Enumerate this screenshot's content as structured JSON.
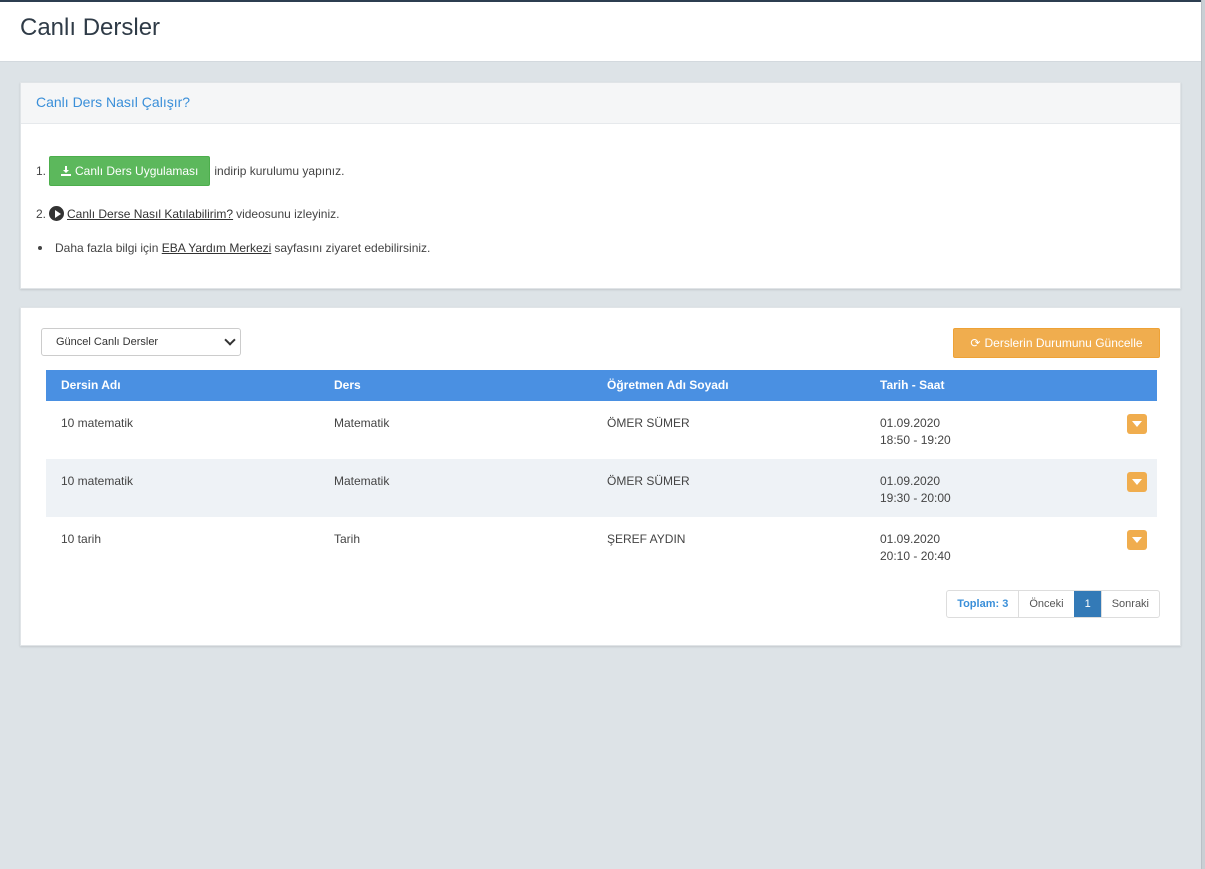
{
  "page": {
    "title": "Canlı Dersler"
  },
  "info": {
    "header": "Canlı Ders Nasıl Çalışır?",
    "step1_num": "1.",
    "download_btn": "Canlı Ders Uygulaması",
    "step1_text": "indirip kurulumu yapınız.",
    "step2_num": "2.",
    "video_link": "Canlı Derse Nasıl Katılabilirim?",
    "step2_text": "videosunu izleyiniz.",
    "more_prefix": "Daha fazla bilgi için",
    "help_link": "EBA Yardım Merkezi",
    "more_suffix": "sayfasını ziyaret edebilirsiniz."
  },
  "filter": {
    "selected": "Güncel Canlı Dersler"
  },
  "refresh_btn": "Derslerin Durumunu Güncelle",
  "table": {
    "headers": [
      "Dersin Adı",
      "Ders",
      "Öğretmen Adı Soyadı",
      "Tarih - Saat"
    ],
    "rows": [
      {
        "name": "10 matematik",
        "course": "Matematik",
        "teacher": "ÖMER SÜMER",
        "date": "01.09.2020",
        "time": "18:50 - 19:20"
      },
      {
        "name": "10 matematik",
        "course": "Matematik",
        "teacher": "ÖMER SÜMER",
        "date": "01.09.2020",
        "time": "19:30 - 20:00"
      },
      {
        "name": "10 tarih",
        "course": "Tarih",
        "teacher": "ŞEREF AYDIN",
        "date": "01.09.2020",
        "time": "20:10 - 20:40"
      }
    ]
  },
  "pager": {
    "total": "Toplam: 3",
    "prev": "Önceki",
    "page": "1",
    "next": "Sonraki"
  },
  "icons": {
    "download": "download-icon",
    "play": "play-circle-icon",
    "refresh": "refresh-icon",
    "caret": "caret-down-icon"
  },
  "colors": {
    "primary": "#4a90e2",
    "success": "#5cb85c",
    "warning": "#f0ad4e",
    "link": "#3a8fd9"
  }
}
